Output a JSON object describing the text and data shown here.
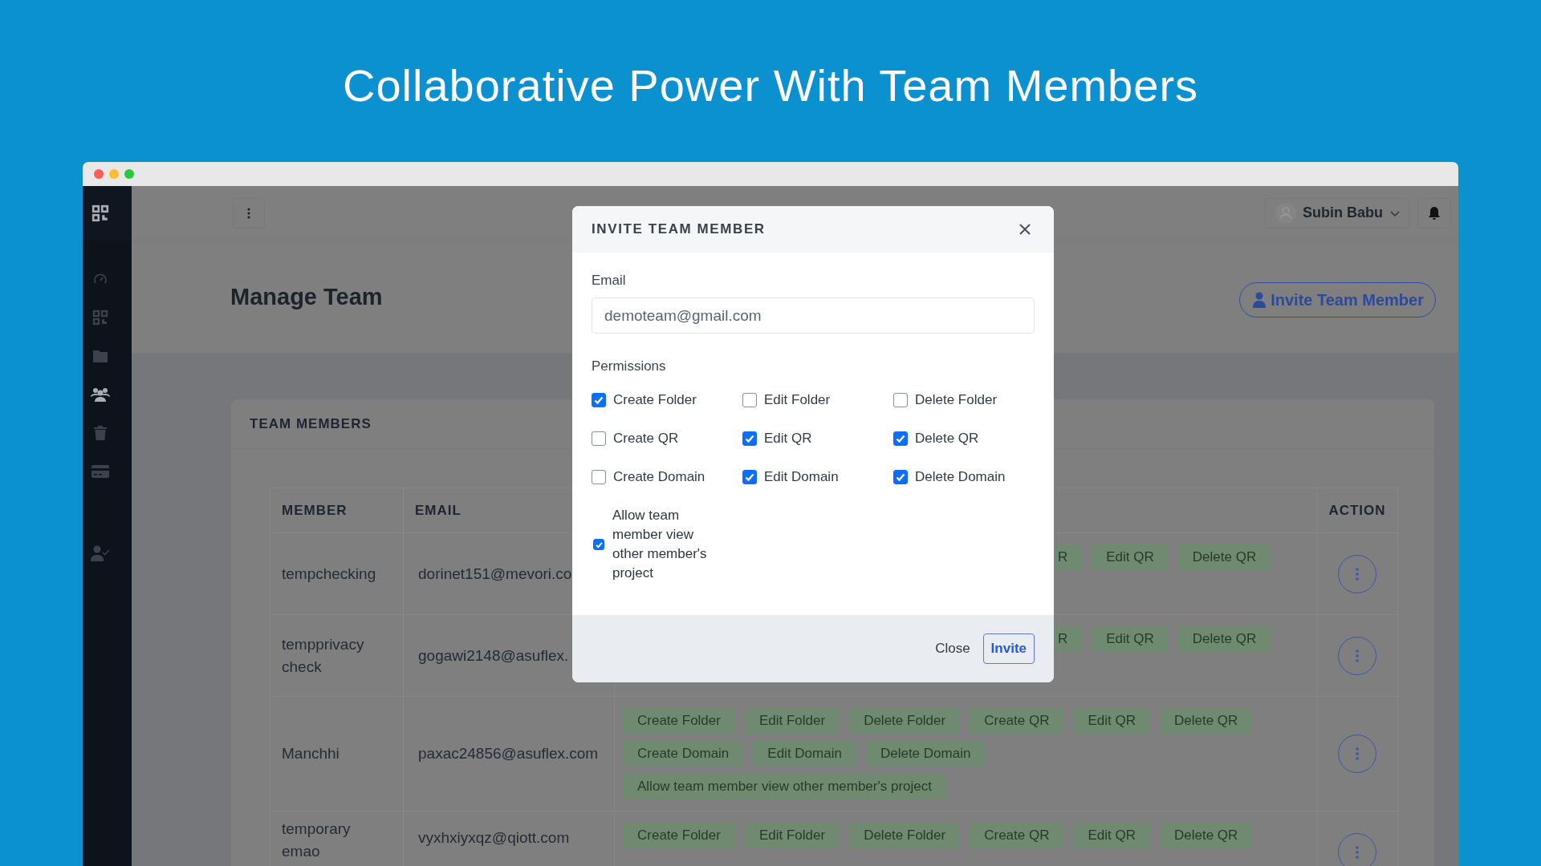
{
  "headline": "Collaborative Power With Team Members",
  "sidebar": {
    "items": [
      {
        "kind": "gauge",
        "selected": false
      },
      {
        "kind": "qr",
        "selected": false
      },
      {
        "kind": "folder",
        "selected": false
      },
      {
        "kind": "team",
        "selected": true
      },
      {
        "kind": "trash",
        "selected": false
      },
      {
        "kind": "card",
        "selected": false
      },
      {
        "kind": "user-check",
        "selected": false
      }
    ]
  },
  "topbar": {
    "user": "Subin Babu"
  },
  "page": {
    "title": "Manage Team",
    "invite_button": "Invite Team Member"
  },
  "card": {
    "title": "TEAM MEMBERS",
    "table": {
      "columns": [
        "MEMBER",
        "EMAIL",
        "ACTION"
      ],
      "rows": [
        {
          "member": "tempchecking",
          "email": "dorinet151@mevori.co",
          "partly_hidden": true,
          "permissions": [
            "R",
            "Edit QR",
            "Delete QR"
          ]
        },
        {
          "member": "tempprivacy check",
          "email": "gogawi2148@asuflex.",
          "partly_hidden": true,
          "permissions": [
            "R",
            "Edit QR",
            "Delete QR"
          ]
        },
        {
          "member": "Manchhi",
          "email": "paxac24856@asuflex.com",
          "partly_hidden": false,
          "permissions": [
            "Create Folder",
            "Edit Folder",
            "Delete Folder",
            "Create QR",
            "Edit QR",
            "Delete QR",
            "Create Domain",
            "Edit Domain",
            "Delete Domain",
            "Allow team member view other member's project"
          ]
        },
        {
          "member": "temporary emao",
          "email": "vyxhxiyxqz@qiott.com",
          "partly_hidden": false,
          "permissions": [
            "Create Folder",
            "Edit Folder",
            "Delete Folder",
            "Create QR",
            "Edit QR",
            "Delete QR"
          ]
        }
      ]
    }
  },
  "modal": {
    "title": "INVITE TEAM MEMBER",
    "email_label": "Email",
    "email_value": "demoteam@gmail.com",
    "permissions_label": "Permissions",
    "permissions": [
      {
        "label": "Create Folder",
        "checked": true
      },
      {
        "label": "Edit Folder",
        "checked": false
      },
      {
        "label": "Delete Folder",
        "checked": false
      },
      {
        "label": "Create QR",
        "checked": false
      },
      {
        "label": "Edit QR",
        "checked": true
      },
      {
        "label": "Delete QR",
        "checked": true
      },
      {
        "label": "Create Domain",
        "checked": false
      },
      {
        "label": "Edit Domain",
        "checked": true
      },
      {
        "label": "Delete Domain",
        "checked": true
      }
    ],
    "allow": {
      "label": "Allow team member view other member's project",
      "checked": true
    },
    "buttons": [
      {
        "label": "Close",
        "kind": "plain"
      },
      {
        "label": "Invite",
        "kind": "outline"
      }
    ]
  }
}
